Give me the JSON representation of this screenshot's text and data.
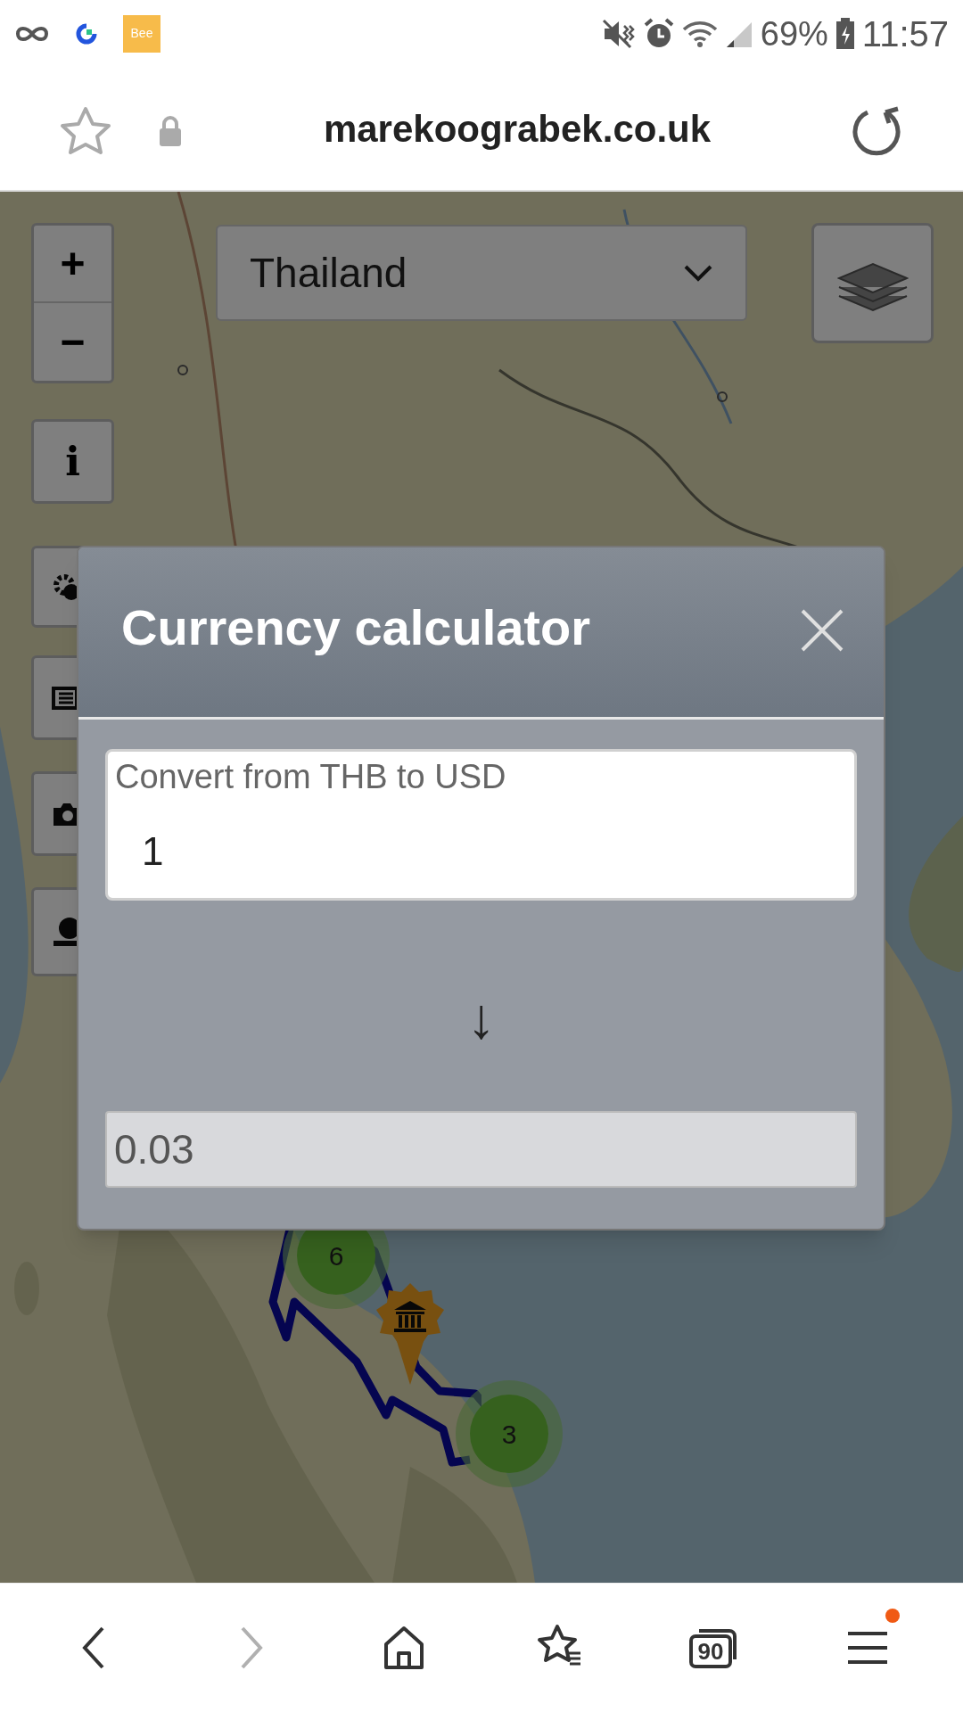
{
  "status_bar": {
    "app_badge": "Bee",
    "battery": "69%",
    "time": "11:57"
  },
  "address_bar": {
    "url": "marekoograbek.co.uk"
  },
  "map": {
    "zoom_in": "+",
    "zoom_out": "−",
    "info": "i",
    "country_select": {
      "value": "Thailand"
    },
    "clusters": [
      {
        "count": "6"
      },
      {
        "count": "3"
      }
    ]
  },
  "dialog": {
    "title": "Currency calculator",
    "input": {
      "label": "Convert from THB to USD",
      "value": "1"
    },
    "arrow": "↓",
    "result": {
      "value": "0.03"
    }
  },
  "bottom_nav": {
    "items": [
      {
        "kind": "back",
        "disabled": false,
        "notification": false
      },
      {
        "kind": "forward",
        "disabled": true,
        "notification": false
      },
      {
        "kind": "home",
        "disabled": false,
        "notification": false
      },
      {
        "kind": "bookmarks",
        "disabled": false,
        "notification": false
      },
      {
        "kind": "tabs",
        "count": "90",
        "disabled": false,
        "notification": false
      },
      {
        "kind": "menu",
        "disabled": false,
        "notification": true
      }
    ]
  }
}
